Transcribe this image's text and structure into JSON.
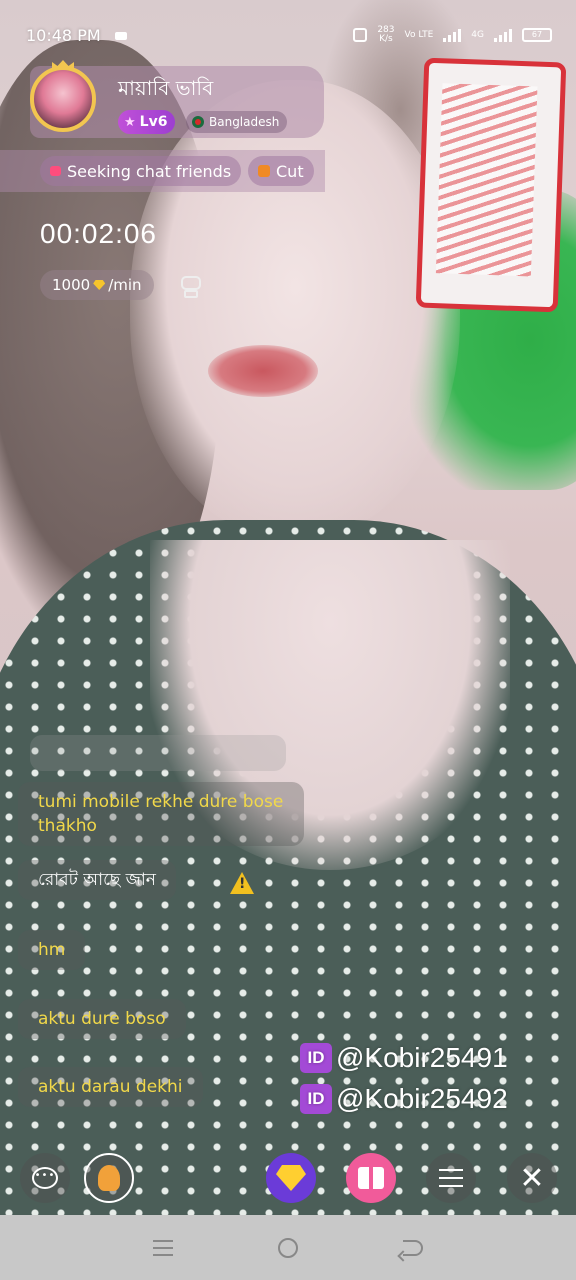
{
  "status_bar": {
    "time": "10:48 PM",
    "net_speed_top": "283",
    "net_speed_bottom": "K/s",
    "signal1": "Vo LTE",
    "signal2": "4G",
    "battery": "67"
  },
  "host": {
    "name": "মায়াবি ভাবি",
    "level": "Lv6",
    "country": "Bangladesh"
  },
  "tags": [
    "Seeking chat friends",
    "Cut"
  ],
  "call": {
    "timer": "00:02:06",
    "rate_amount": "1000",
    "rate_unit": "/min"
  },
  "chat": {
    "messages": [
      {
        "text": "tumi mobile rekhe dure bose thakho",
        "color": "yellow"
      },
      {
        "text": "রোবট আছে জান",
        "color": "white"
      },
      {
        "text": "hm",
        "color": "yellow"
      },
      {
        "text": "aktu dure boso",
        "color": "yellow"
      },
      {
        "text": "aktu darau dekhi",
        "color": "yellow"
      }
    ]
  },
  "watermark": {
    "id_label": "ID",
    "line1": "@Kobir25491",
    "line2": "@Kobir25492"
  },
  "actions": {
    "chat_icon_text": "•••",
    "close_symbol": "✕"
  },
  "colors": {
    "level_badge": "#b04ad6",
    "gem_button": "#6b3bd8",
    "gift_button": "#f15b9a",
    "chat_text": "#f1d84a"
  }
}
